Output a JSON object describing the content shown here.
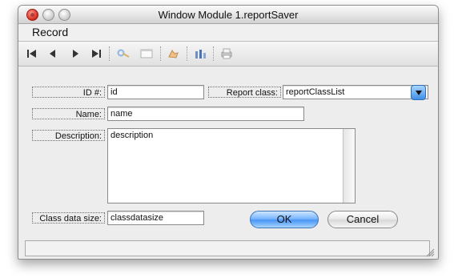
{
  "window": {
    "title": "Window Module 1.reportSaver"
  },
  "menu": {
    "items": [
      "Record"
    ]
  },
  "toolbar": {
    "icons": [
      "first-record-icon",
      "previous-record-icon",
      "next-record-icon",
      "last-record-icon",
      "key-icon",
      "window-icon",
      "edit-icon",
      "sort-icon",
      "print-icon"
    ]
  },
  "form": {
    "id_label": "ID #:",
    "id_value": "id",
    "report_class_label": "Report class:",
    "report_class_value": "reportClassList",
    "name_label": "Name:",
    "name_value": "name",
    "description_label": "Description:",
    "description_value": "description",
    "class_data_size_label": "Class data size:",
    "class_data_size_value": "classdatasize"
  },
  "buttons": {
    "ok": "OK",
    "cancel": "Cancel"
  },
  "colors": {
    "accent": "#4a95f4",
    "window_bg": "#ededed"
  }
}
